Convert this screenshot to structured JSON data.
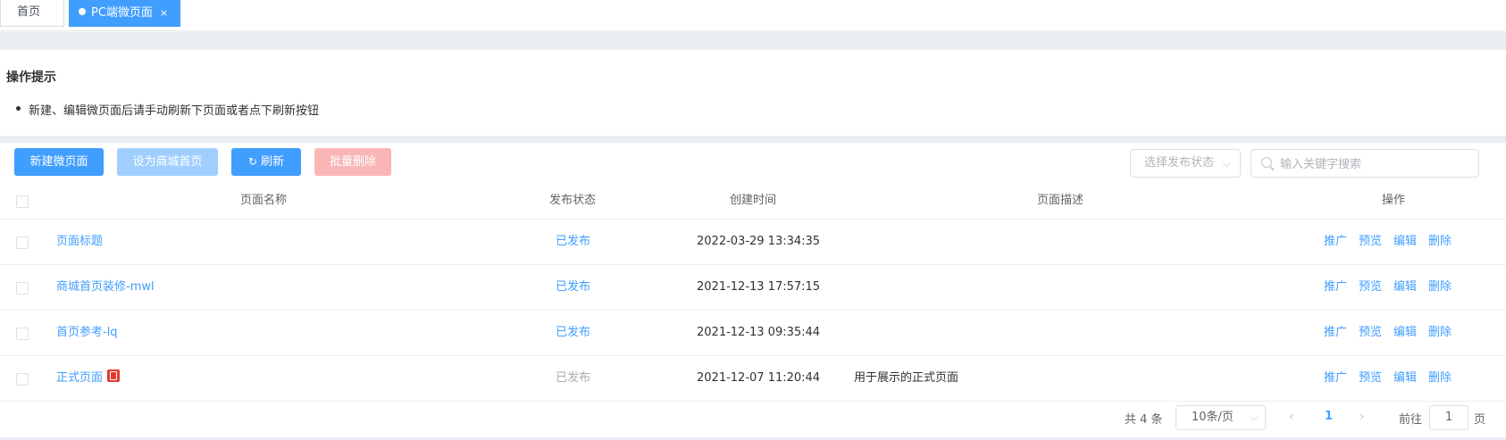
{
  "tabs": {
    "home_label": "首页",
    "active_label": "PC端微页面",
    "close_symbol": "×"
  },
  "notice": {
    "title": "操作提示",
    "items": [
      "新建、编辑微页面后请手动刷新下页面或者点下刷新按钮"
    ]
  },
  "toolbar": {
    "new_label": "新建微页面",
    "set_home_label": "设为商城首页",
    "refresh_label": "刷新",
    "batch_delete_label": "批量删除",
    "status_select_placeholder": "选择发布状态",
    "search_placeholder": "输入关键字搜索"
  },
  "table": {
    "columns": [
      "页面名称",
      "发布状态",
      "创建时间",
      "页面描述",
      "操作"
    ],
    "rows": [
      {
        "name": "页面标题",
        "status": "已发布",
        "created": "2022-03-29 13:34:35",
        "desc": ""
      },
      {
        "name": "商城首页装修-mwl",
        "status": "已发布",
        "created": "2021-12-13 17:57:15",
        "desc": ""
      },
      {
        "name": "首页参考-lq",
        "status": "已发布",
        "created": "2021-12-13 09:35:44",
        "desc": ""
      },
      {
        "name": "正式页面",
        "status": "已发布",
        "created": "2021-12-07 11:20:44",
        "desc": "用于展示的正式页面"
      }
    ],
    "actions": [
      "推广",
      "预览",
      "编辑",
      "删除"
    ]
  },
  "pagination": {
    "total_text": "共 4 条",
    "page_size": "10条/页",
    "current_page": "1",
    "goto_label": "前往",
    "goto_value": "1",
    "page_unit": "页"
  },
  "colors": {
    "primary": "#409eff",
    "primary_light": "#a0cfff",
    "danger_light": "#fab6b6",
    "home_tag": "#e4392b"
  }
}
